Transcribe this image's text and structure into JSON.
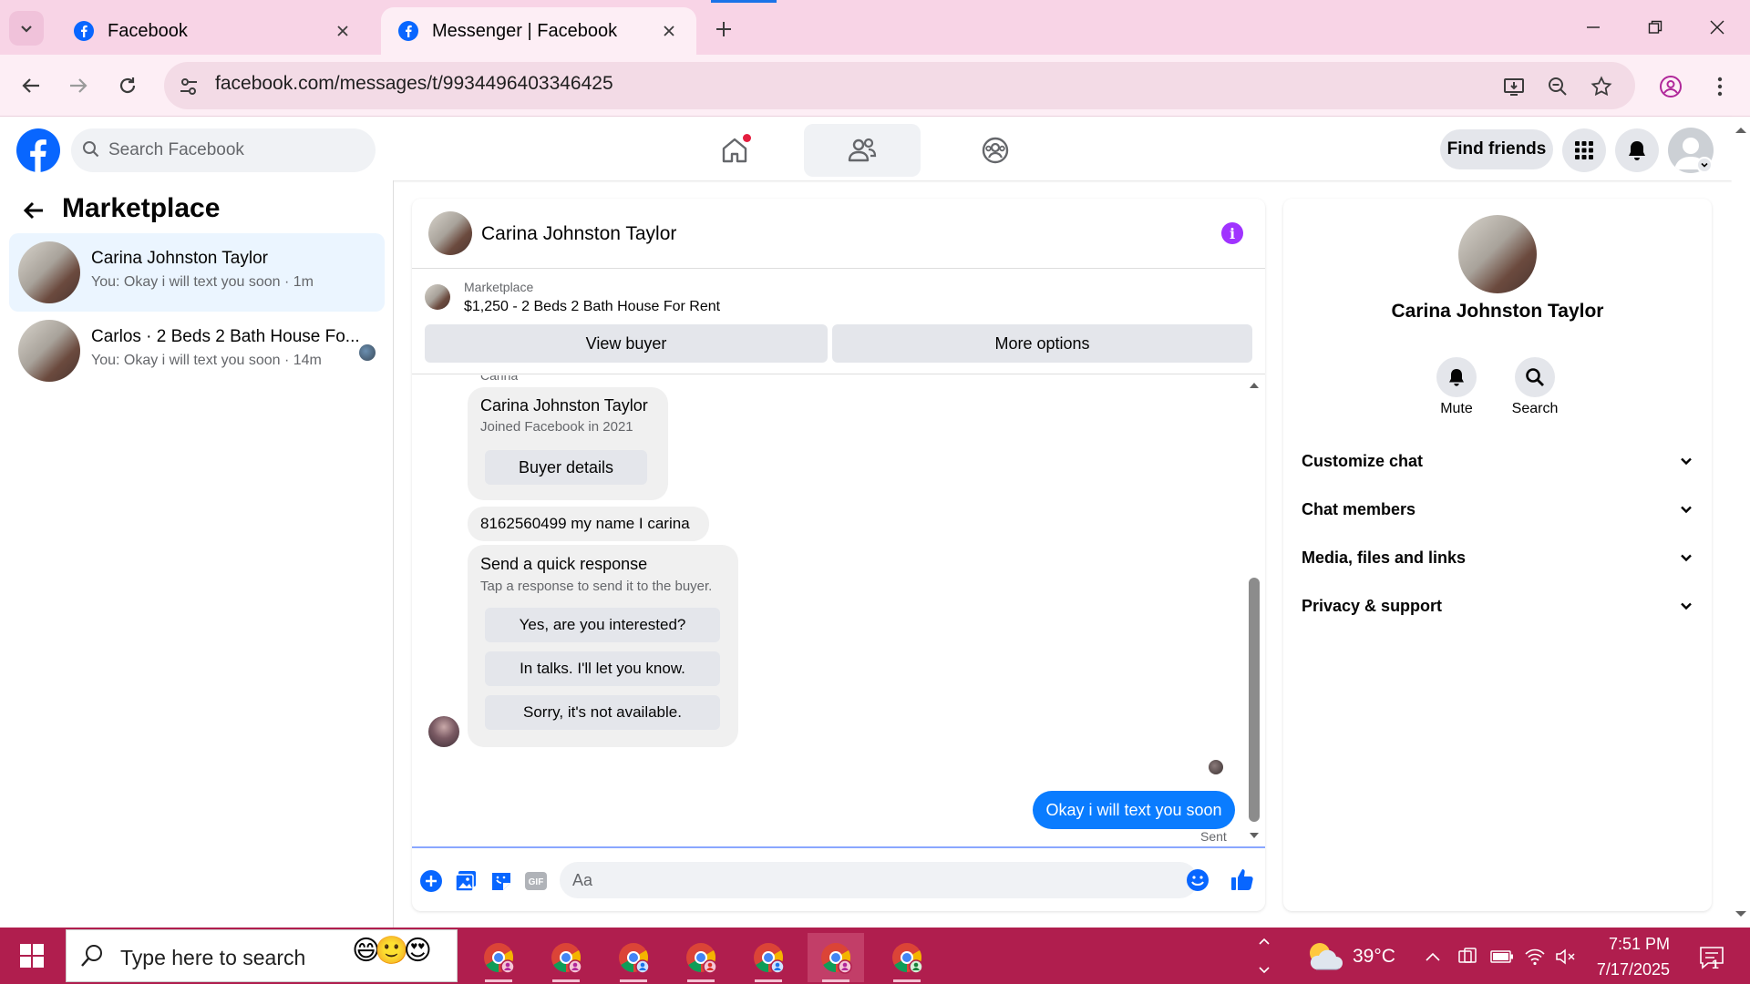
{
  "browser": {
    "tabs": [
      {
        "title": "Facebook",
        "active": false
      },
      {
        "title": "Messenger | Facebook",
        "active": true
      }
    ],
    "url": "facebook.com/messages/t/9934496403346425"
  },
  "fb_header": {
    "search_placeholder": "Search Facebook",
    "find_friends_label": "Find friends"
  },
  "left_panel": {
    "title": "Marketplace",
    "conversations": [
      {
        "name": "Carina Johnston Taylor",
        "snippet": "You: Okay i will text you soon · 1m",
        "selected": true
      },
      {
        "name": "Carlos · 2 Beds 2 Bath House Fo...",
        "snippet": "You: Okay i will text you soon · 14m",
        "selected": false
      }
    ]
  },
  "chat": {
    "contact_name": "Carina Johnston Taylor",
    "listing": {
      "label": "Marketplace",
      "title": "$1,250 - 2 Beds 2 Bath House For Rent",
      "view_buyer_label": "View buyer",
      "more_options_label": "More options"
    },
    "sender_label": "Carina",
    "buyer_card": {
      "name": "Carina Johnston Taylor",
      "joined": "Joined Facebook in 2021",
      "button_label": "Buyer details"
    },
    "incoming_message": "8162560499 my name I carina",
    "quick_response": {
      "title": "Send a quick response",
      "subtitle": "Tap a response to send it to the buyer.",
      "options": [
        "Yes, are you interested?",
        "In talks. I'll let you know.",
        "Sorry, it's not available."
      ]
    },
    "outgoing_message": "Okay i will text you soon",
    "outgoing_status": "Sent",
    "composer_placeholder": "Aa",
    "composer_icons": [
      "plus-icon",
      "photo-icon",
      "sticker-icon",
      "gif-icon",
      "emoji-icon",
      "like-icon"
    ]
  },
  "info_panel": {
    "name": "Carina Johnston Taylor",
    "actions": [
      {
        "label": "Mute",
        "icon": "bell-icon"
      },
      {
        "label": "Search",
        "icon": "search-icon"
      }
    ],
    "sections": [
      "Customize chat",
      "Chat members",
      "Media, files and links",
      "Privacy & support"
    ]
  },
  "taskbar": {
    "search_placeholder": "Type here to search",
    "weather": "39°C",
    "time": "7:51 PM",
    "date": "7/17/2025",
    "notification_count": "1"
  },
  "colors": {
    "accent_blue": "#0a7cff",
    "facebook_blue": "#0866ff",
    "info_purple": "#a033ff",
    "taskbar": "#b01e4e",
    "tab_strip": "#f8d4e6"
  }
}
